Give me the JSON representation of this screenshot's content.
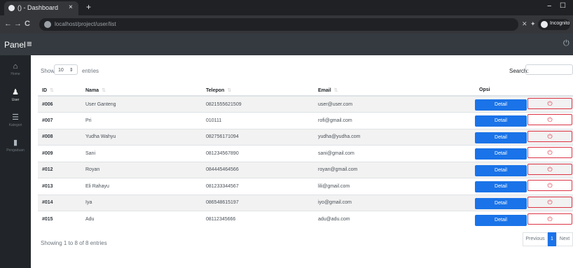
{
  "browser": {
    "tab_title": "() - Dashboard",
    "tab_close": "×",
    "new_tab": "+",
    "url": "localhost/project/user/list",
    "profile_label": "Incognito",
    "back": "←",
    "forward": "→",
    "reload": "C",
    "minimize": "−",
    "maximize": "☐"
  },
  "header": {
    "brand": "Panel",
    "menu_icon": "≡",
    "power_icon": "⏻"
  },
  "sidebar": {
    "items": [
      {
        "label": "Home",
        "icon": "home-icon",
        "glyph": "⌂"
      },
      {
        "label": "User",
        "icon": "user-icon",
        "glyph": "👤"
      },
      {
        "label": "Kategori",
        "icon": "list-icon",
        "glyph": "☰"
      },
      {
        "label": "Pengaduan",
        "icon": "file-icon",
        "glyph": "▮"
      }
    ]
  },
  "controls": {
    "show_label": "Show",
    "show_value": "10",
    "entries_label": "entries",
    "search_label": "Search:"
  },
  "table": {
    "columns": [
      "ID",
      "Nama",
      "Telepon",
      "Email",
      "Opsi"
    ],
    "rows": [
      {
        "id": "#006",
        "nama": "User Ganteng",
        "telepon": "0821555621509",
        "email": "user@user.com"
      },
      {
        "id": "#007",
        "nama": "Pri",
        "telepon": "010111",
        "email": "rofi@gmail.com"
      },
      {
        "id": "#008",
        "nama": "Yudha Wahyu",
        "telepon": "082756171094",
        "email": "yudha@yudha.com"
      },
      {
        "id": "#009",
        "nama": "Sani",
        "telepon": "081234567890",
        "email": "sani@gmail.com"
      },
      {
        "id": "#012",
        "nama": "Royan",
        "telepon": "084445464566",
        "email": "royan@gmail.com"
      },
      {
        "id": "#013",
        "nama": "Eli Rahayu",
        "telepon": "081233344567",
        "email": "lili@gmail.com"
      },
      {
        "id": "#014",
        "nama": "Iya",
        "telepon": "086548615197",
        "email": "iyo@gmail.com"
      },
      {
        "id": "#015",
        "nama": "Adu",
        "telepon": "08112345666",
        "email": "adu@adu.com"
      }
    ],
    "detail_label": "Detail",
    "delete_glyph": "⏻"
  },
  "footer": {
    "info": "Showing 1 to 8 of 8 entries",
    "previous": "Previous",
    "page": "1",
    "next": "Next"
  },
  "colors": {
    "primary": "#1a73e8",
    "danger": "#dc3545",
    "header": "#343a40",
    "sidebar": "#212529"
  }
}
